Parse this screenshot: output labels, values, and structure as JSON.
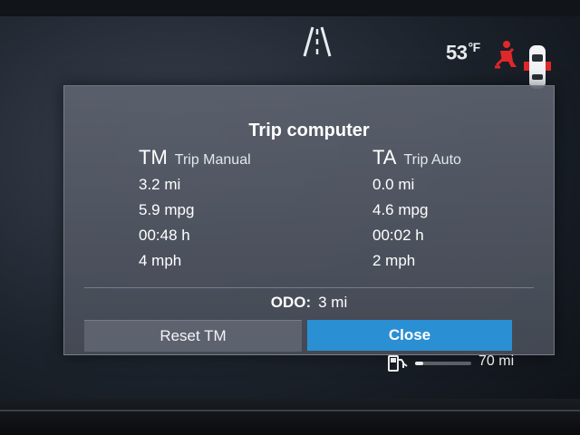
{
  "status": {
    "temperature": "53",
    "temperature_unit": "°F",
    "icons": [
      "lane-assist-icon",
      "seatbelt-warning-icon",
      "car-doors-icon"
    ],
    "warning_color": "#e0282a"
  },
  "trip_computer": {
    "title": "Trip computer",
    "trip_manual": {
      "abbr": "TM",
      "label": "Trip Manual",
      "distance": "3.2 mi",
      "economy": "5.9 mpg",
      "time": "00:48 h",
      "speed": "4 mph"
    },
    "trip_auto": {
      "abbr": "TA",
      "label": "Trip Auto",
      "distance": "0.0 mi",
      "economy": "4.6 mpg",
      "time": "00:02 h",
      "speed": "2 mph"
    },
    "odometer": {
      "label": "ODO:",
      "value": "3 mi"
    },
    "buttons": {
      "reset": "Reset TM",
      "close": "Close"
    },
    "accent_color": "#2b8fd4"
  },
  "fuel": {
    "range": "70 mi",
    "level_fraction": 0.15
  }
}
